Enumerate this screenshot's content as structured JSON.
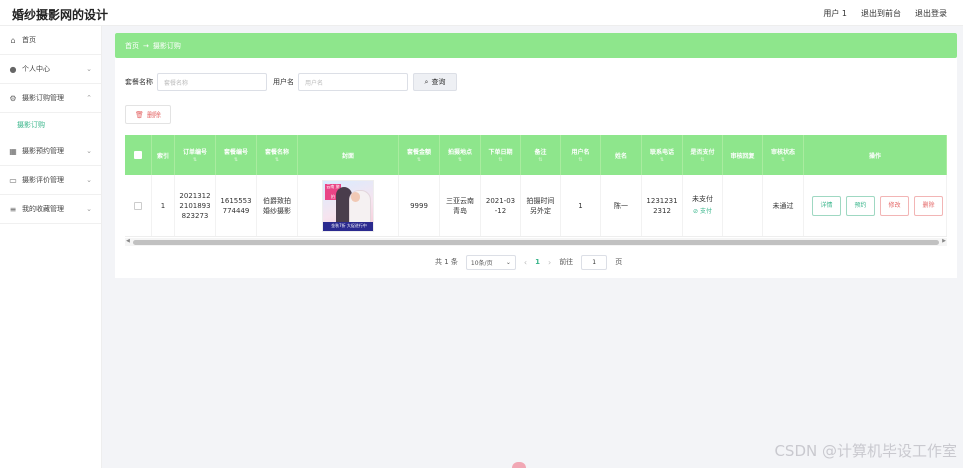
{
  "app": {
    "title": "婚纱摄影网的设计"
  },
  "top_right": {
    "user": "用户 1",
    "front": "退出到前台",
    "logout": "退出登录"
  },
  "sidebar": {
    "items": [
      {
        "label": "首页",
        "icon": "home-icon"
      },
      {
        "label": "个人中心",
        "icon": "user-icon"
      },
      {
        "label": "摄影订购管理",
        "icon": "settings-icon"
      },
      {
        "label": "摄影订购",
        "icon": ""
      },
      {
        "label": "摄影预约管理",
        "icon": "calendar-icon"
      },
      {
        "label": "摄影评价管理",
        "icon": "monitor-icon"
      },
      {
        "label": "我的收藏管理",
        "icon": "list-icon"
      }
    ]
  },
  "breadcrumb": {
    "home": "首页",
    "sep": "→",
    "current": "摄影订购"
  },
  "search": {
    "package_label": "套餐名称",
    "package_placeholder": "套餐名称",
    "user_label": "用户名",
    "user_placeholder": "用户名",
    "search_btn": "查询"
  },
  "toolbar": {
    "delete_label": "删除"
  },
  "table": {
    "headers": [
      "索引",
      "订单编号",
      "套餐编号",
      "套餐名称",
      "封面",
      "套餐金额",
      "拍摄地点",
      "下单日期",
      "备注",
      "用户名",
      "姓名",
      "联系电话",
      "是否支付",
      "审核回复",
      "审核状态",
      "操作"
    ],
    "row": {
      "index": "1",
      "order_no": "2021312 2101893 823273",
      "package_no": "1615553 774449",
      "package_name": "伯爵致拍 婚纱摄影",
      "cover_badge": "云南 旅拍",
      "cover_banner": "金秋7折 大促进行中",
      "amount": "9999",
      "location": "三亚云南 青岛",
      "date": "2021-03 -12",
      "remark": "拍摄时间 另外定",
      "username": "1",
      "name": "陈一",
      "phone": "1231231 2312",
      "paid": "未支付",
      "pay_link": "支付",
      "reply": "",
      "status": "未通过",
      "ops": [
        "详情",
        "预约",
        "修改",
        "删除"
      ]
    }
  },
  "pager": {
    "total": "共 1 条",
    "page_size": "10条/页",
    "current": "1",
    "goto_label": "前往",
    "goto_value": "1",
    "page_unit": "页"
  },
  "watermark": "CSDN @计算机毕设工作室",
  "colors": {
    "accent": "#8ee68c",
    "link": "#37b58a",
    "danger": "#e46767"
  }
}
